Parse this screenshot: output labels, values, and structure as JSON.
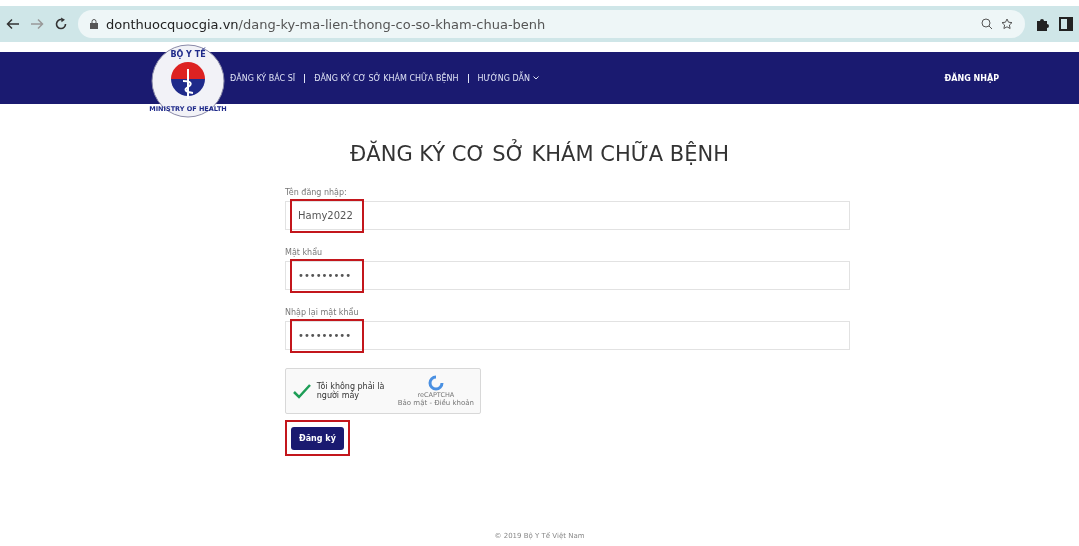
{
  "browser": {
    "url_host": "donthuocquocgia.vn",
    "url_path": "/dang-ky-ma-lien-thong-co-so-kham-chua-benh"
  },
  "logo": {
    "top_text": "BỘ Y TẾ",
    "bottom_text": "MINISTRY OF HEALTH"
  },
  "nav": {
    "items": [
      {
        "label": "ĐĂNG KÝ BÁC SĨ",
        "dropdown": false
      },
      {
        "label": "ĐĂNG KÝ CƠ SỞ KHÁM CHỮA BỆNH",
        "dropdown": false
      },
      {
        "label": "HƯỚNG DẪN",
        "dropdown": true
      }
    ],
    "login": "ĐĂNG NHẬP"
  },
  "title": "ĐĂNG KÝ CƠ SỞ KHÁM CHỮA BỆNH",
  "fields": [
    {
      "label": "Tên đăng nhập:",
      "value": "Hamy2022",
      "highlighted": true
    },
    {
      "label": "Mật khẩu",
      "value": "•••••••••",
      "highlighted": true
    },
    {
      "label": "Nhập lại mật khẩu",
      "value": "•••••••••",
      "highlighted": true
    }
  ],
  "captcha": {
    "checked": true,
    "label": "Tôi không phải là người máy",
    "brand": "reCAPTCHA",
    "links": "Bảo mật - Điều khoản"
  },
  "submit": {
    "label": "Đăng ký",
    "highlighted": true
  },
  "footer": "© 2019 Bộ Y Tế Việt Nam"
}
